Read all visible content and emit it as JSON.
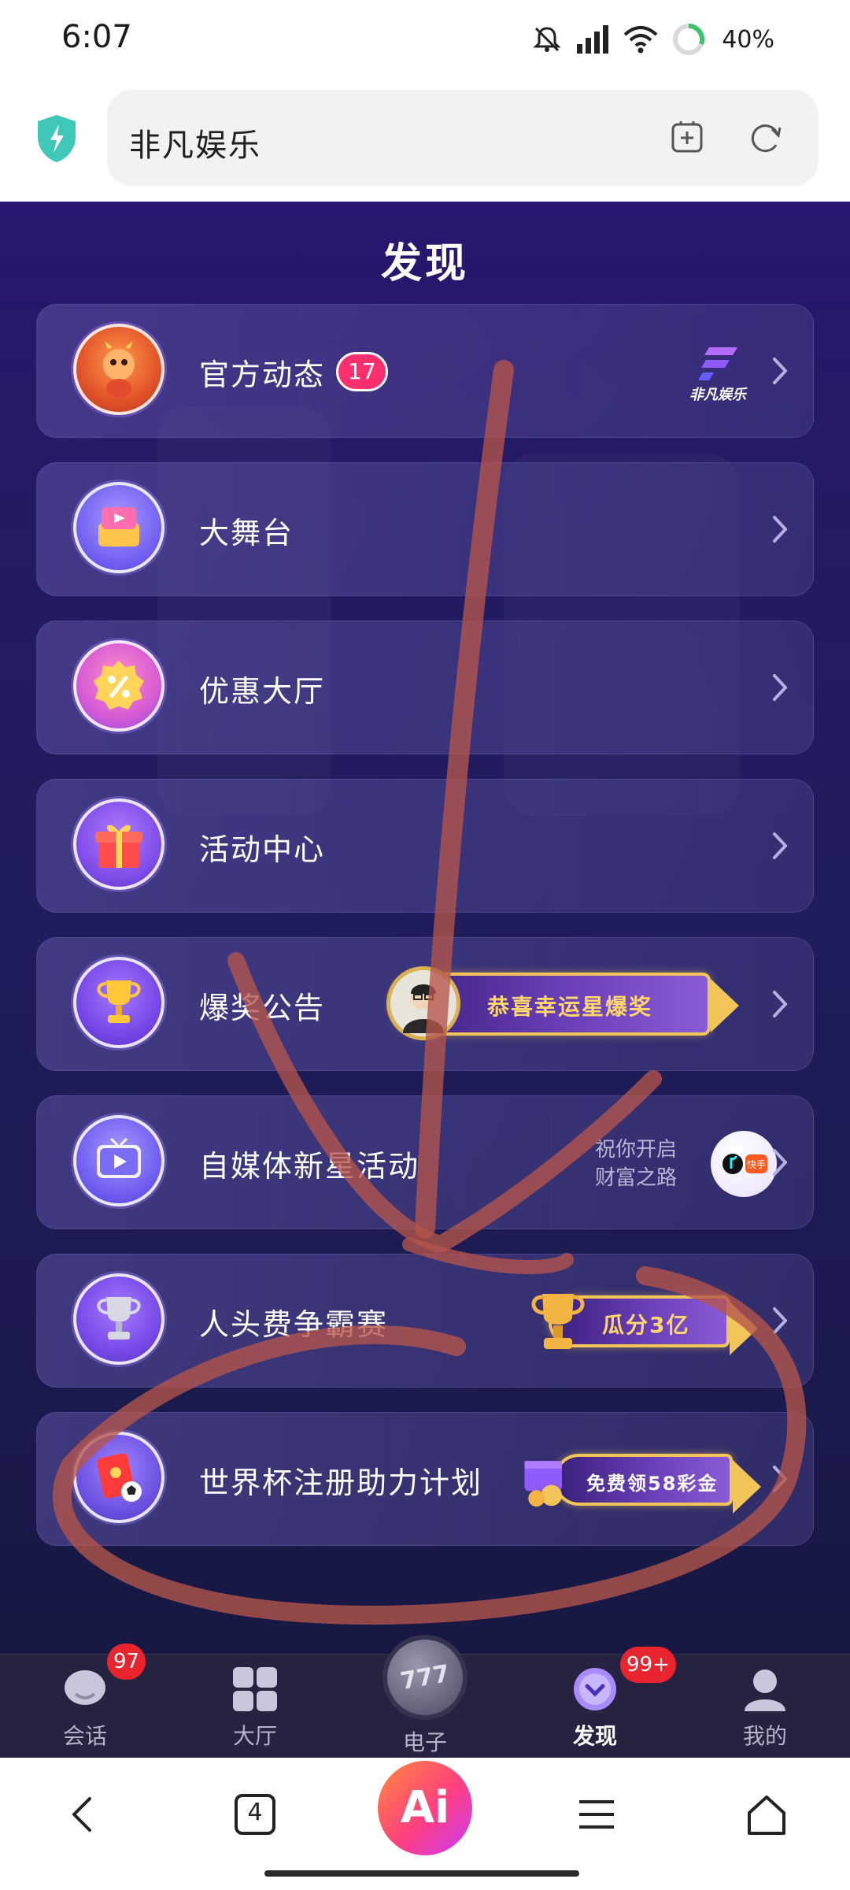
{
  "status_bar": {
    "time": "6:07",
    "battery": "40%",
    "icons": [
      "mute-bell-icon",
      "signal-icon",
      "wifi-icon",
      "battery-ring-icon"
    ]
  },
  "browser": {
    "url_text": "非凡娱乐",
    "icons": [
      "shield-icon",
      "add-tab-icon",
      "refresh-icon"
    ]
  },
  "page": {
    "title": "发现",
    "items": [
      {
        "label": "官方动态",
        "badge": "17",
        "brand": "非凡娱乐",
        "icon": "dragon-mascot-icon"
      },
      {
        "label": "大舞台",
        "icon": "stage-box-icon"
      },
      {
        "label": "优惠大厅",
        "icon": "discount-icon"
      },
      {
        "label": "活动中心",
        "icon": "gift-box-icon"
      },
      {
        "label": "爆奖公告",
        "icon": "trophy-icon",
        "banner": "恭喜幸运星爆奖"
      },
      {
        "label": "自媒体新星活动",
        "icon": "tv-play-icon",
        "promo": "祝你开启财富之路",
        "social": "快手"
      },
      {
        "label": "人头费争霸赛",
        "icon": "silver-trophy-icon",
        "banner": "瓜分3亿"
      },
      {
        "label": "世界杯注册助力计划",
        "icon": "red-envelope-ball-icon",
        "banner": "免费领58彩金"
      }
    ]
  },
  "tabs": [
    {
      "label": "会话",
      "badge": "97",
      "icon": "chat-bubble-icon"
    },
    {
      "label": "大厅",
      "icon": "grid-icon"
    },
    {
      "label": "电子",
      "icon": "slot-777-icon"
    },
    {
      "label": "发现",
      "badge": "99+",
      "icon": "discover-icon",
      "active": true
    },
    {
      "label": "我的",
      "icon": "profile-icon"
    }
  ],
  "sys_nav": {
    "tab_count": "4",
    "ai_label": "Ai"
  },
  "colors": {
    "page_bg": "#241a66",
    "card_bg": "#5f52a5",
    "badge_pink": "#ff2f6f",
    "badge_red": "#e8252e",
    "banner_gold": "#f2c55a",
    "annotation": "#b5544a"
  }
}
